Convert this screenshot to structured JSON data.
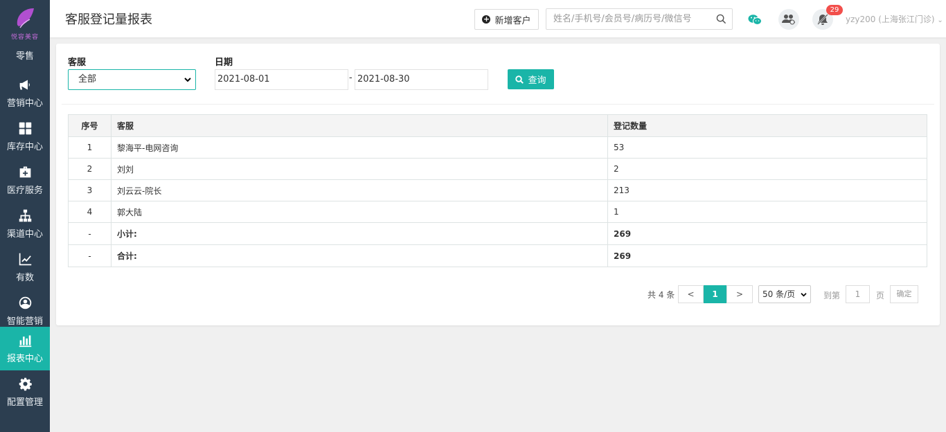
{
  "brand": {
    "logo_text": "悦容美容",
    "accent": "#1ab5a8",
    "sidebar_bg": "#2c3e50"
  },
  "sidebar": {
    "items": [
      {
        "label": "零售",
        "icon": "retail-icon"
      },
      {
        "label": "营销中心",
        "icon": "megaphone-icon"
      },
      {
        "label": "库存中心",
        "icon": "grid-icon"
      },
      {
        "label": "医疗服务",
        "icon": "medical-kit-icon"
      },
      {
        "label": "渠道中心",
        "icon": "sitemap-icon"
      },
      {
        "label": "有数",
        "icon": "line-chart-icon"
      },
      {
        "label": "智能营销",
        "icon": "smart-marketing-icon"
      },
      {
        "label": "报表中心",
        "icon": "bar-chart-icon",
        "active": true
      },
      {
        "label": "配置管理",
        "icon": "gear-icon"
      }
    ]
  },
  "header": {
    "title": "客服登记量报表",
    "add_customer_label": "新增客户",
    "search_placeholder": "姓名/手机号/会员号/病历号/微信号",
    "notification_count": "29",
    "user": "yzy200 (上海张江门诊)"
  },
  "filters": {
    "staff_label": "客服",
    "staff_value": "全部",
    "date_label": "日期",
    "date_from": "2021-08-01",
    "date_separator": "-",
    "date_to": "2021-08-30",
    "query_label": "查询"
  },
  "table": {
    "headers": [
      "序号",
      "客服",
      "登记数量"
    ],
    "rows": [
      [
        "1",
        "黎海平-电网咨询",
        "53"
      ],
      [
        "2",
        "刘刘",
        "2"
      ],
      [
        "3",
        "刘云云-院长",
        "213"
      ],
      [
        "4",
        "郭大陆",
        "1"
      ]
    ],
    "subtotal": [
      "-",
      "小计:",
      "269"
    ],
    "total": [
      "-",
      "合计:",
      "269"
    ]
  },
  "pagination": {
    "total_text": "共 4 条",
    "prev": "<",
    "current": "1",
    "next": ">",
    "page_size": "50 条/页",
    "goto_label": "到第",
    "goto_value": "1",
    "page_unit": "页",
    "confirm": "确定"
  }
}
